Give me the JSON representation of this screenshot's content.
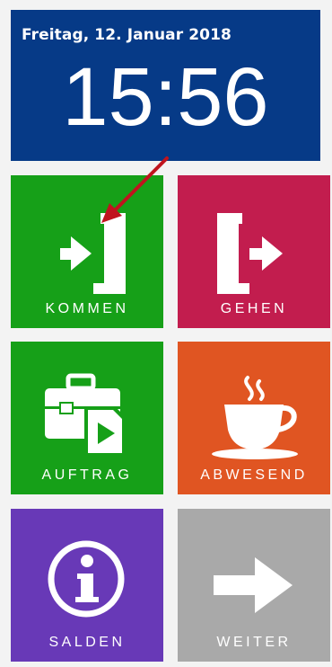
{
  "clock": {
    "date": "Freitag, 12. Januar 2018",
    "time": "15:56"
  },
  "tiles": {
    "kommen": {
      "label": "KOMMEN",
      "icon": "enter-door-icon",
      "color": "#16a018"
    },
    "gehen": {
      "label": "GEHEN",
      "icon": "exit-door-icon",
      "color": "#c21d4e"
    },
    "auftrag": {
      "label": "AUFTRAG",
      "icon": "briefcase-document-icon",
      "color": "#16a018"
    },
    "abwesend": {
      "label": "ABWESEND",
      "icon": "coffee-cup-icon",
      "color": "#e05522"
    },
    "salden": {
      "label": "SALDEN",
      "icon": "info-icon",
      "color": "#6839b7"
    },
    "weiter": {
      "label": "WEITER",
      "icon": "arrow-right-icon",
      "color": "#a9a9a9"
    }
  },
  "annotation": {
    "icon": "red-pointer-arrow",
    "color": "#c0141e"
  }
}
